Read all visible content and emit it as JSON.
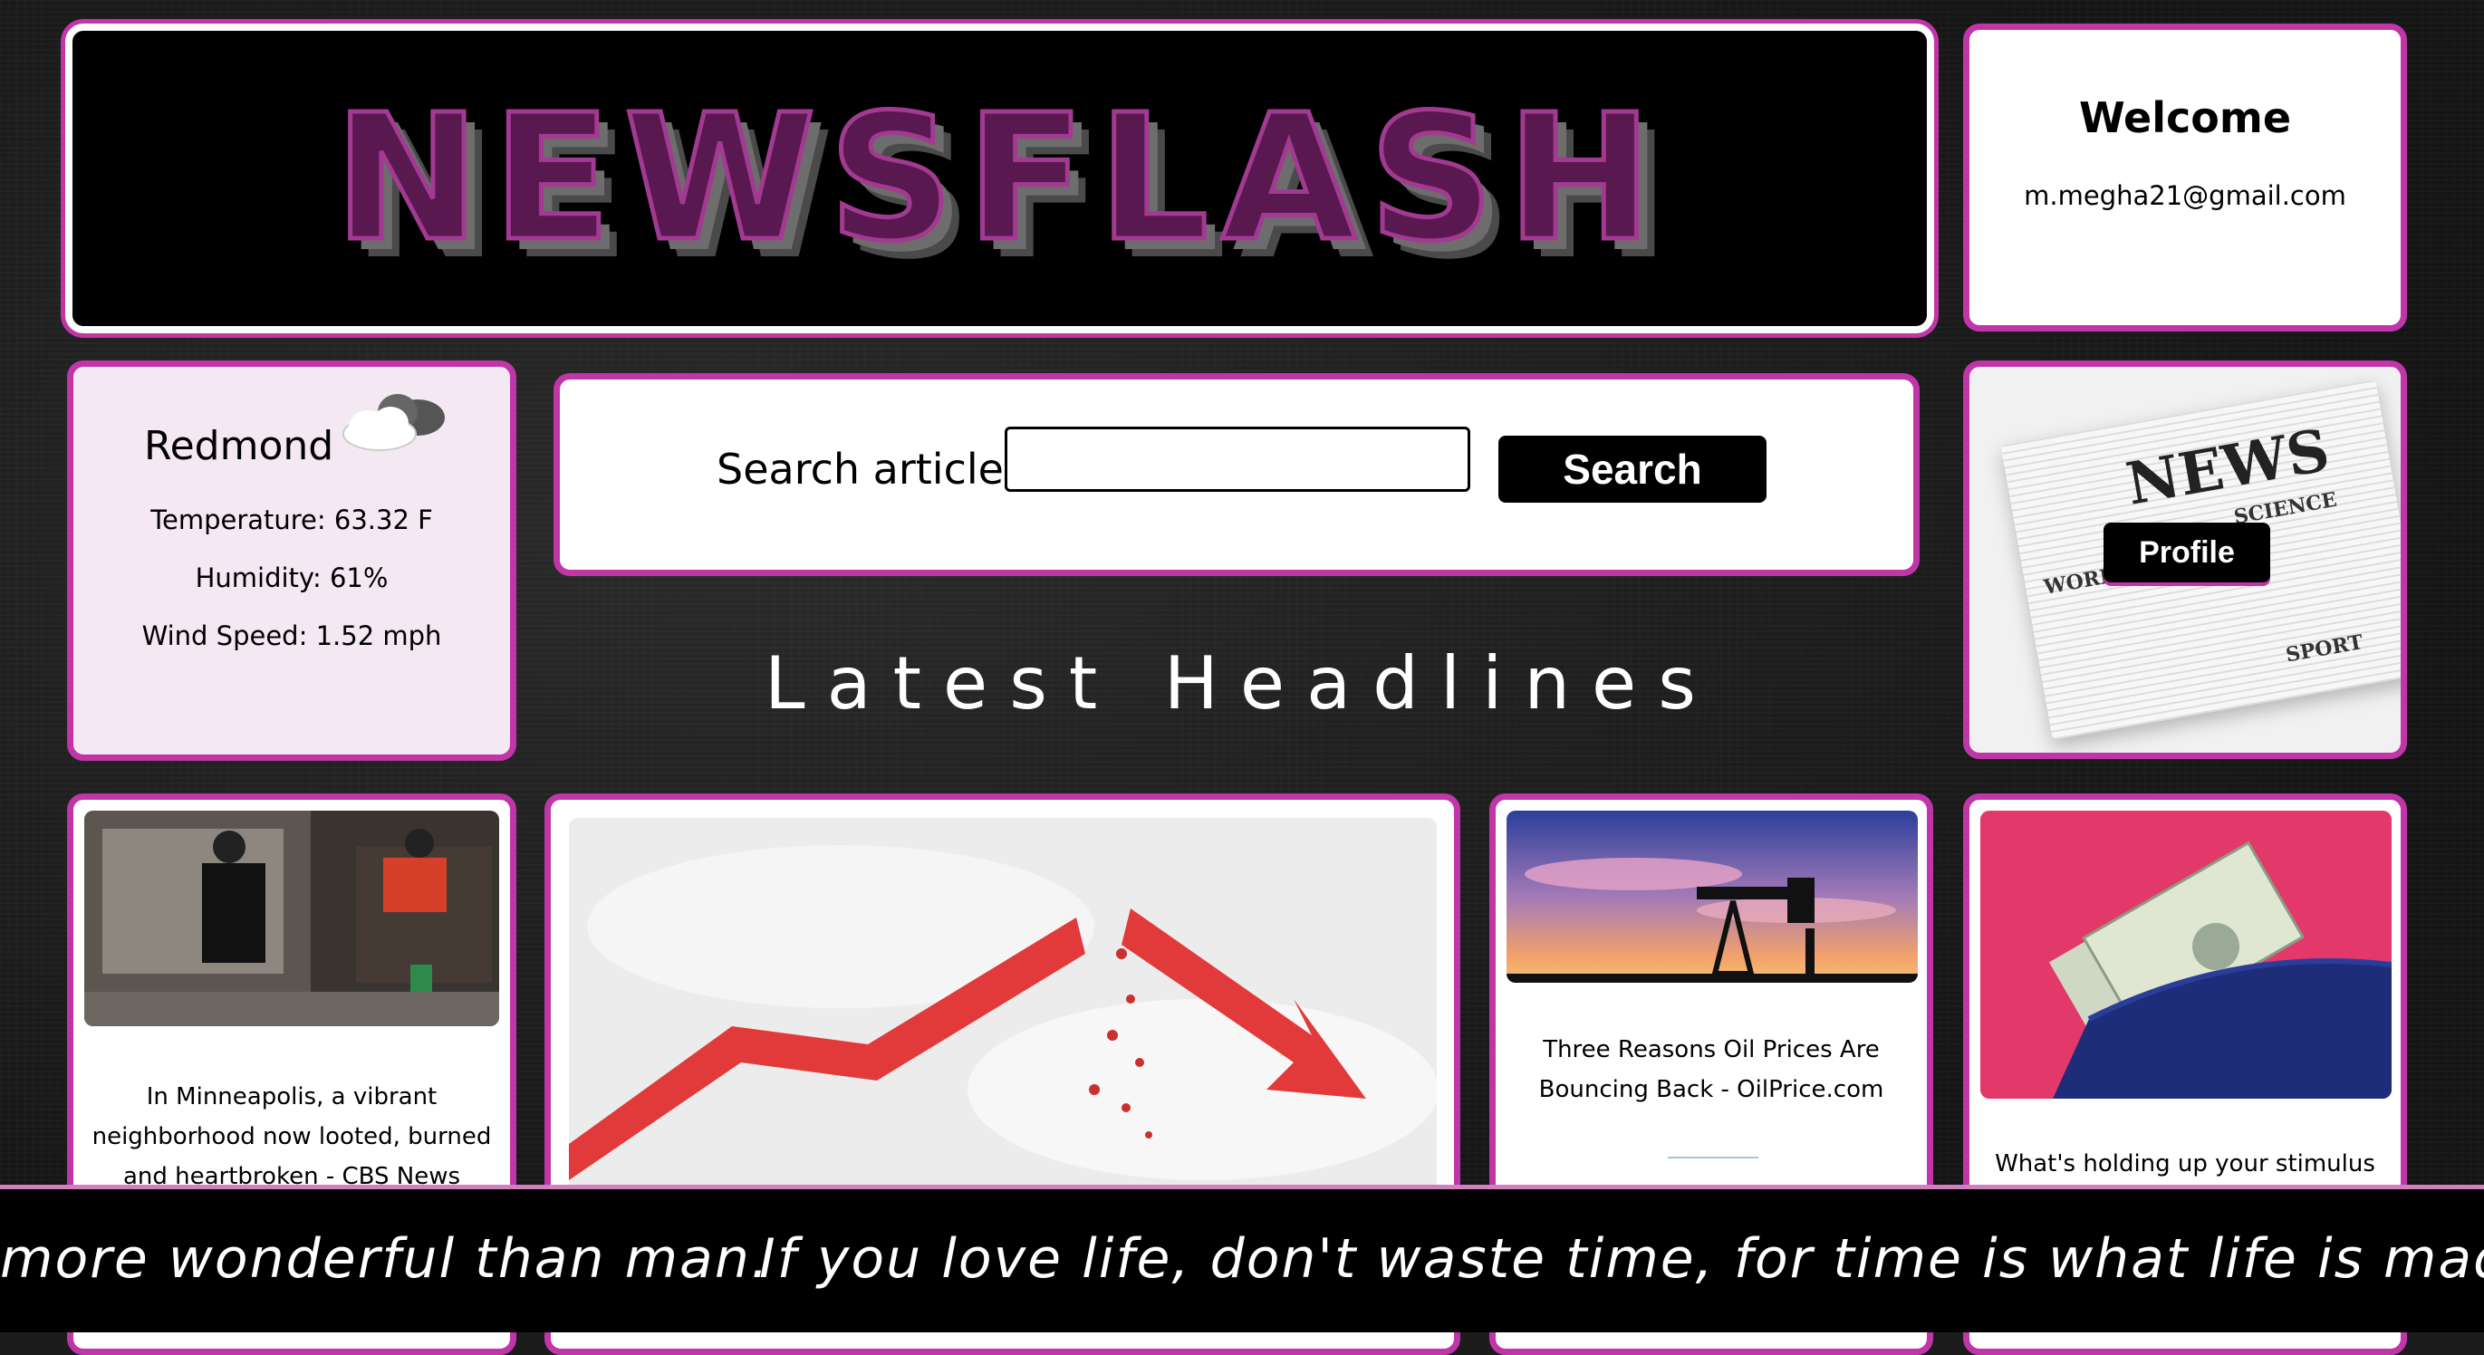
{
  "banner": {
    "logo_text": "NEWSFLASH"
  },
  "welcome": {
    "title": "Welcome",
    "email": "m.megha21@gmail.com"
  },
  "weather": {
    "city": "Redmond",
    "icon": "cloud-icon",
    "temperature": "Temperature: 63.32 F",
    "humidity": "Humidity: 61%",
    "wind": "Wind Speed: 1.52 mph"
  },
  "search": {
    "label": "Search articles:",
    "value": "",
    "placeholder": "",
    "button": "Search"
  },
  "headline": "Latest Headlines",
  "news_card": {
    "paper_title": "NEWS",
    "paper_sections": [
      "SCIENCE",
      "WORLD",
      "SPORT"
    ],
    "profile_button": "Profile"
  },
  "articles": [
    {
      "title": "In Minneapolis, a vibrant neighborhood now looted, burned and heartbroken - CBS News"
    },
    {
      "title": ""
    },
    {
      "title": "Three Reasons Oil Prices Are Bouncing Back - OilPrice.com"
    },
    {
      "title": "What's holding up your stimulus"
    }
  ],
  "ticker": {
    "quote_1": "more wonderful than man.",
    "quote_2": "If you love life, don't waste time, for time is what life is made up of."
  },
  "colors": {
    "accent": "#c035a8",
    "background": "#1c1c1c"
  }
}
